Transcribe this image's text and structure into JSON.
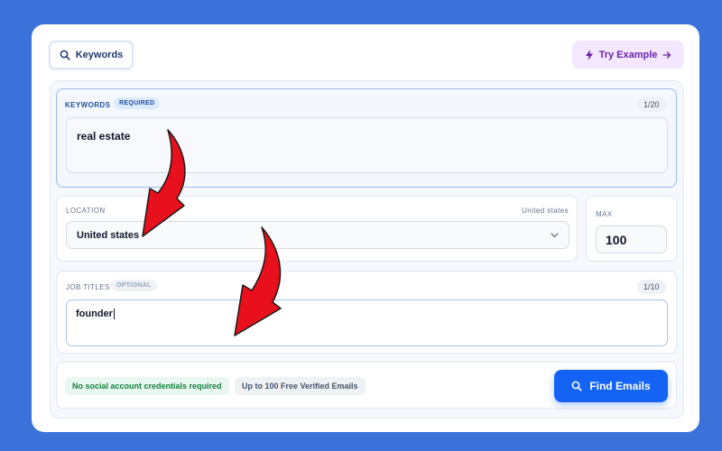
{
  "header": {
    "keywords_tab": "Keywords",
    "try_example": "Try Example"
  },
  "keywords": {
    "label": "KEYWORDS",
    "badge": "REQUIRED",
    "counter": "1/20",
    "value": "real estate"
  },
  "location": {
    "label": "LOCATION",
    "hint": "United states",
    "value": "United states"
  },
  "max": {
    "label": "MAX",
    "value": "100"
  },
  "job_titles": {
    "label": "JOB TITLES",
    "badge": "OPTIONAL",
    "counter": "1/10",
    "value": "founder"
  },
  "footer": {
    "no_credentials": "No social account credentials required",
    "free_emails": "Up to 100 Free Verified Emails",
    "find_button": "Find Emails"
  },
  "colors": {
    "background": "#3b72d9",
    "primary_button": "#1463f5",
    "annotation_arrow": "#e8101c"
  },
  "icons": [
    "search-icon",
    "bolt-icon",
    "arrow-right-icon",
    "chevron-down-icon"
  ]
}
